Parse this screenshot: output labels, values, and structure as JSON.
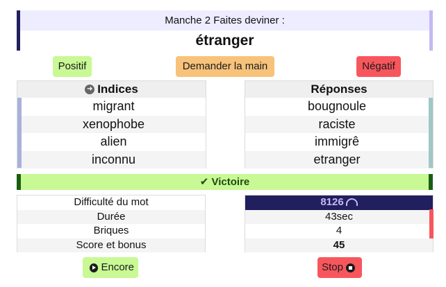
{
  "header": {
    "round_line": "Manche 2 Faites deviner :",
    "word": "étranger"
  },
  "actions": {
    "positive_label": "Positif",
    "ask_hand_label": "Demander la main",
    "negative_label": "Négatif"
  },
  "clues": {
    "title": "Indices",
    "icon": "arrow-circle-icon",
    "items": [
      "migrant",
      "xenophobe",
      "alien",
      "inconnu"
    ]
  },
  "answers": {
    "title": "Réponses",
    "items": [
      "bougnoule",
      "raciste",
      "immigrê",
      "etranger"
    ]
  },
  "result": {
    "label": "Victoire",
    "icon": "check-icon"
  },
  "stats": {
    "labels": [
      "Difficulté du mot",
      "Durée",
      "Briques",
      "Score et bonus"
    ],
    "values": [
      "8126",
      "43sec",
      "4",
      "45"
    ],
    "difficulty_icon": "gauge-icon"
  },
  "footer": {
    "encore_label": "Encore",
    "stop_label": "Stop"
  },
  "colors": {
    "positive": "#c8f995",
    "ask": "#f7c27a",
    "negative": "#f8565d",
    "header_bg": "#eeecff",
    "dark_accent": "#221f5f"
  }
}
